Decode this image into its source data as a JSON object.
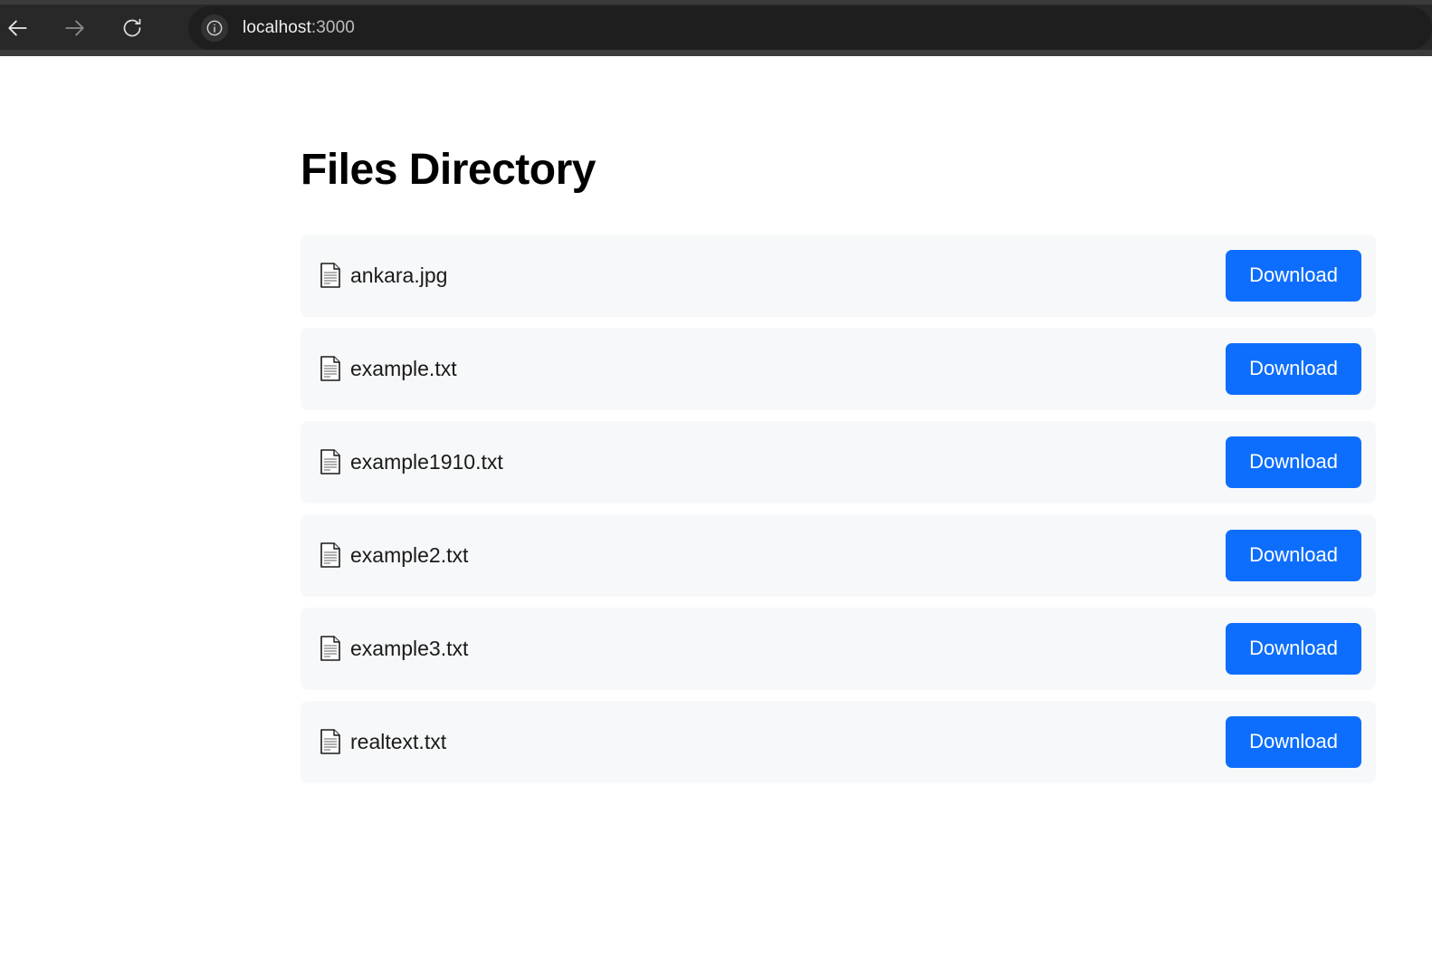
{
  "browser": {
    "back_icon": "arrow-left-icon",
    "forward_icon": "arrow-right-icon",
    "reload_icon": "reload-icon",
    "site_info_icon": "info-circle-icon",
    "url_host": "localhost",
    "url_port": ":3000",
    "url_full": "localhost:3000"
  },
  "page": {
    "title": "Files Directory"
  },
  "files": [
    {
      "icon": "document-icon",
      "name": "ankara.jpg",
      "action_label": "Download"
    },
    {
      "icon": "document-icon",
      "name": "example.txt",
      "action_label": "Download"
    },
    {
      "icon": "document-icon",
      "name": "example1910.txt",
      "action_label": "Download"
    },
    {
      "icon": "document-icon",
      "name": "example2.txt",
      "action_label": "Download"
    },
    {
      "icon": "document-icon",
      "name": "example3.txt",
      "action_label": "Download"
    },
    {
      "icon": "document-icon",
      "name": "realtext.txt",
      "action_label": "Download"
    }
  ],
  "colors": {
    "accent": "#0d6efd",
    "row_background": "#f7f8f9",
    "page_background": "#ffffff",
    "chrome_background": "#282828"
  }
}
